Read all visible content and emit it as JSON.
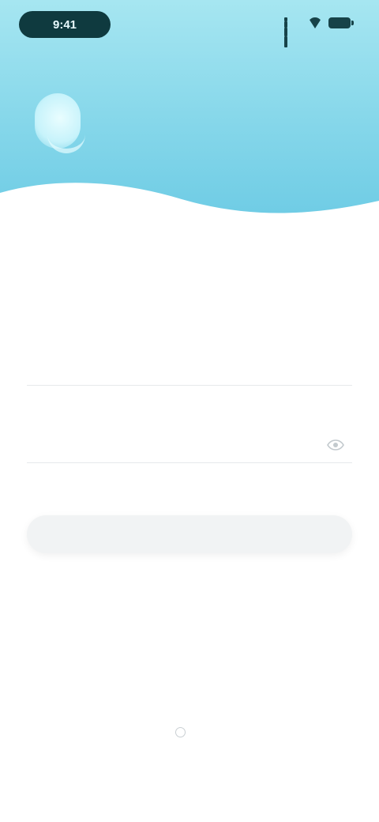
{
  "status_bar": {
    "time": "9:41"
  },
  "hero": {
    "tagline": ""
  },
  "form": {
    "title": "",
    "account_label": "",
    "account_value": "",
    "account_placeholder": "",
    "password_label": "",
    "password_value": "",
    "password_placeholder": "",
    "forgot_label": "",
    "login_label": ""
  },
  "agreement": {
    "prefix": "",
    "link1": "",
    "join": "",
    "link2": ""
  },
  "colors": {
    "hero_top": "#a6e6f1",
    "hero_bottom": "#62c6e2",
    "button_bg": "#f1f3f4",
    "link": "#7ec9dc"
  }
}
